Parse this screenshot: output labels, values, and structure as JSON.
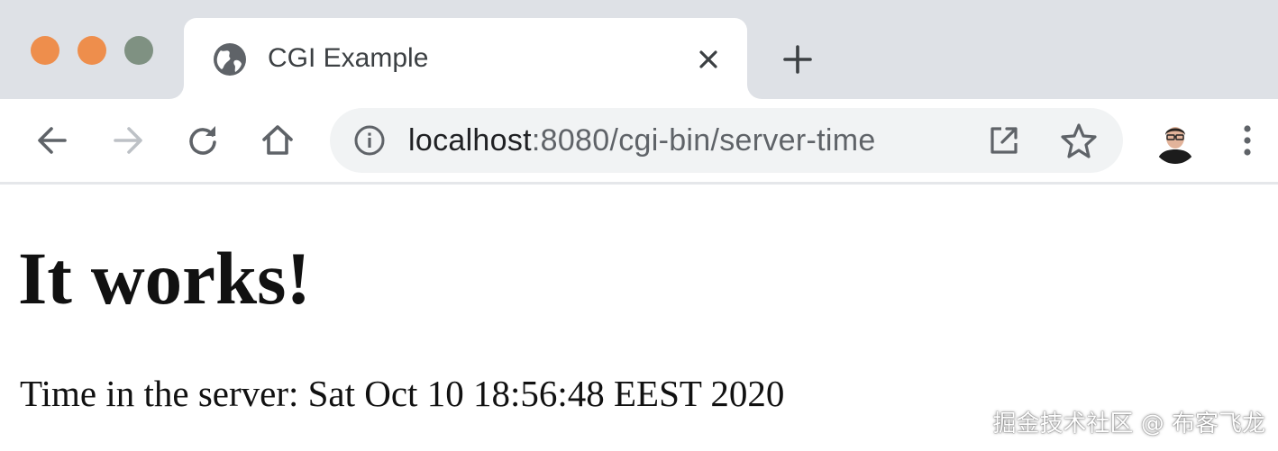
{
  "window": {
    "traffic_lights": {
      "close_color": "#ee8e4c",
      "minimize_color": "#ee8e4c",
      "zoom_color": "#7f9182"
    }
  },
  "tab": {
    "title": "CGI Example",
    "favicon": "globe-icon",
    "close_icon": "close-icon"
  },
  "new_tab_icon": "plus-icon",
  "toolbar": {
    "back_icon": "back-arrow-icon",
    "forward_icon": "forward-arrow-icon",
    "reload_icon": "reload-icon",
    "home_icon": "home-icon",
    "profile_icon": "avatar",
    "menu_icon": "kebab-menu-icon"
  },
  "omnibox": {
    "site_info_icon": "info-icon",
    "url_host": "localhost",
    "url_rest": ":8080/cgi-bin/server-time",
    "share_icon": "open-in-new-icon",
    "bookmark_icon": "star-icon"
  },
  "page": {
    "heading": "It works!",
    "text": "Time in the server: Sat Oct 10 18:56:48 EEST 2020"
  },
  "watermark": "掘金技术社区 @ 布客飞龙",
  "colors": {
    "tabstrip_bg": "#dee1e6",
    "omnibox_bg": "#f1f3f4",
    "icon_color": "#5f6368"
  }
}
